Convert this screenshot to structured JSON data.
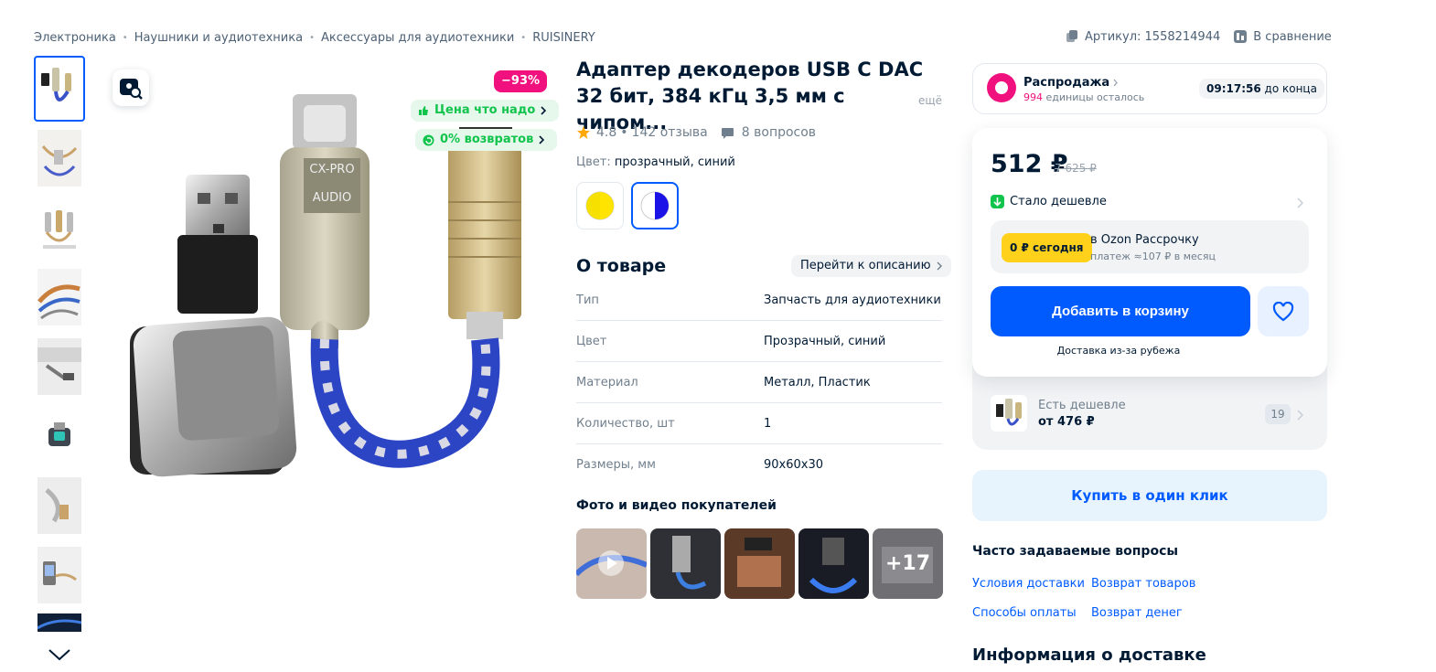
{
  "breadcrumbs": [
    "Электроника",
    "Наушники и аудиотехника",
    "Аксессуары для аудиотехники",
    "RUISINERY"
  ],
  "top_actions": {
    "article_label": "Артикул: 1558214944",
    "compare_label": "В сравнение"
  },
  "gallery": {
    "discount_badge": "−93%",
    "chip_price": "Цена что надо",
    "chip_returns": "0% возвратов",
    "thumb_count": 9
  },
  "product": {
    "title": "Адаптер декодеров USB C DAC 32 бит, 384 кГц 3,5 мм с чипом...",
    "more_label": "ещё",
    "rating": "4.8",
    "reviews": "142 отзыва",
    "questions": "8 вопросов",
    "color_label": "Цвет:",
    "color_value": "прозрачный, синий"
  },
  "about": {
    "heading": "О товаре",
    "goto_description": "Перейти к описанию",
    "specs": [
      {
        "key": "Тип",
        "value": "Запчасть для аудиотехники"
      },
      {
        "key": "Цвет",
        "value": "Прозрачный, синий"
      },
      {
        "key": "Материал",
        "value": "Металл, Пластик"
      },
      {
        "key": "Количество, шт",
        "value": "1"
      },
      {
        "key": "Размеры, мм",
        "value": "90x60x30"
      }
    ]
  },
  "customer_media": {
    "heading": "Фото и видео покупателей",
    "more_count": "+17"
  },
  "sale": {
    "title": "Распродажа",
    "remaining_count": "994",
    "remaining_text": "единицы осталось",
    "timer": "09:17:56",
    "timer_suffix": "до конца"
  },
  "price": {
    "current": "512 ₽",
    "old": "7 625 ₽",
    "cheaper_label": "Стало дешевле",
    "split_badge": "0 ₽ сегодня",
    "split_title": "в Ozon Рассрочку",
    "split_sub": "платеж ≈107 ₽ в месяц",
    "add_to_cart": "Добавить в корзину",
    "delivery_note": "Доставка из-за рубежа"
  },
  "cheaper_offer": {
    "label": "Есть дешевле",
    "price": "от 476 ₽",
    "count": "19"
  },
  "buy_one_click": "Купить в один клик",
  "faq": {
    "heading": "Часто задаваемые вопросы",
    "links": [
      "Условия доставки",
      "Возврат товаров",
      "Способы оплаты",
      "Возврат денег"
    ]
  },
  "delivery_heading": "Информация о доставке",
  "colors": {
    "accent": "#005bff",
    "sale_pink": "#f1117e",
    "good_green": "#10c44c",
    "split_yellow": "#ffd11a"
  }
}
